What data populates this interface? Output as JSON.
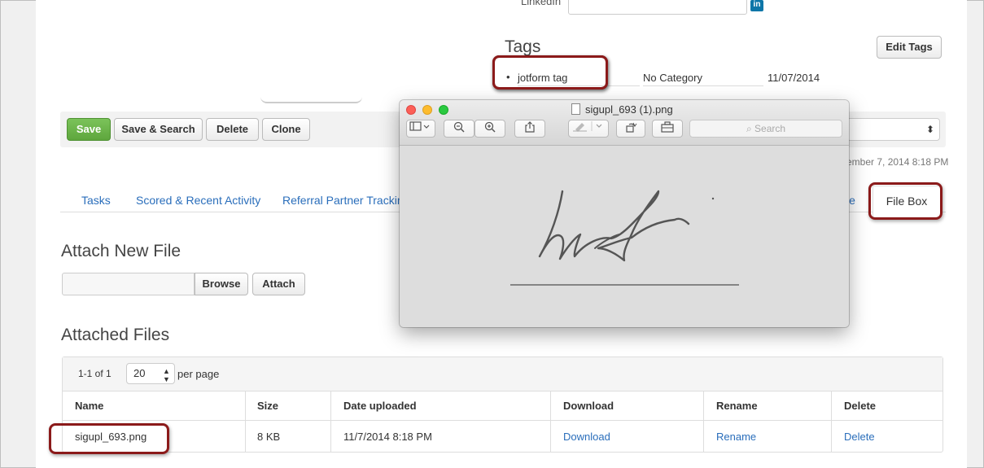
{
  "header": {
    "linkedin_label": "LinkedIn",
    "linkedin_icon": "in"
  },
  "tags": {
    "title": "Tags",
    "edit_label": "Edit Tags",
    "rows": [
      {
        "name": "jotform tag",
        "category": "No Category",
        "date": "11/07/2014"
      }
    ]
  },
  "toolbar": {
    "save_label": "Save",
    "save_search_label": "Save & Search",
    "delete_label": "Delete",
    "clone_label": "Clone",
    "select_arrow": "⬍"
  },
  "meta": {
    "updated_text": "ember 7, 2014 8:18 PM"
  },
  "tabs": {
    "items": [
      "Tasks",
      "Scored & Recent Activity",
      "Referral Partner Tracking",
      "le"
    ],
    "active": "File Box"
  },
  "attach": {
    "title": "Attach New File",
    "browse_label": "Browse",
    "attach_label": "Attach"
  },
  "files": {
    "title": "Attached Files",
    "pager_count": "1-1 of 1",
    "per_page_value": "20",
    "per_page_label": "per page",
    "columns": [
      "Name",
      "Size",
      "Date uploaded",
      "Download",
      "Rename",
      "Delete"
    ],
    "rows": [
      {
        "name": "sigupl_693.png",
        "size": "8 KB",
        "date": "11/7/2014 8:18 PM",
        "download": "Download",
        "rename": "Rename",
        "delete": "Delete"
      }
    ]
  },
  "preview_window": {
    "title": "sigupl_693 (1).png",
    "search_placeholder": "Search"
  },
  "colors": {
    "accent_link": "#2a6ebb",
    "save_green": "#6ab04c",
    "callout_red": "#8b1a1a"
  }
}
